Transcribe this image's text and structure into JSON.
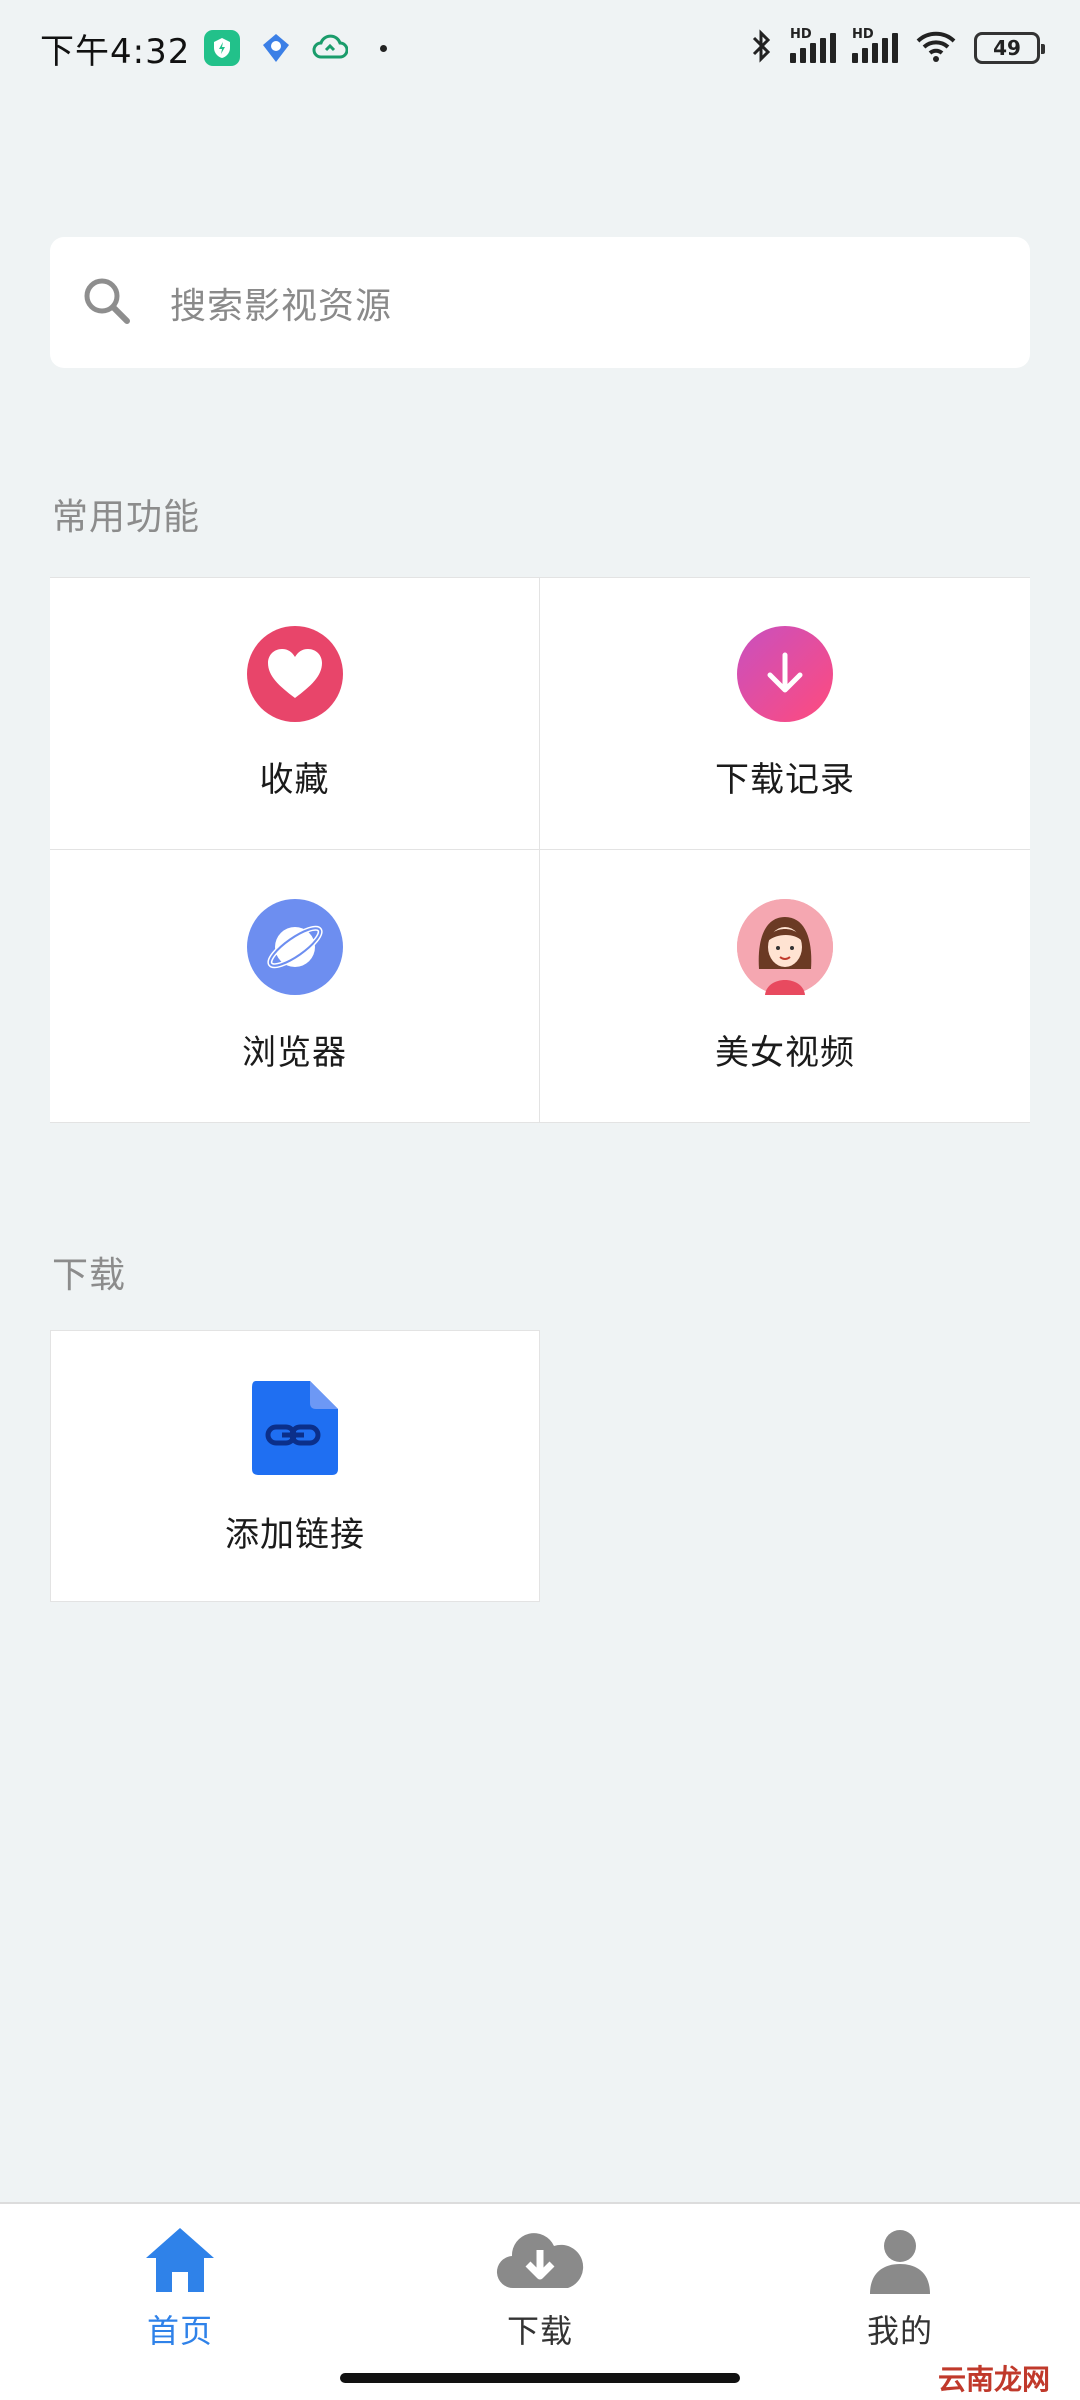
{
  "status_bar": {
    "time": "下午4:32",
    "battery": "49"
  },
  "search": {
    "placeholder": "搜索影视资源"
  },
  "section_common": {
    "title": "常用功能"
  },
  "features": [
    {
      "label": "收藏",
      "icon": "heart-icon",
      "color": "#e8456a"
    },
    {
      "label": "下载记录",
      "icon": "download-arrow-icon",
      "color": "#dd4fa0"
    },
    {
      "label": "浏览器",
      "icon": "planet-icon",
      "color": "#6d8ef0"
    },
    {
      "label": "美女视频",
      "icon": "girl-avatar-icon",
      "color": "#f29aa6"
    }
  ],
  "section_download": {
    "title": "下载",
    "add_link_label": "添加链接",
    "icon": "link-file-icon",
    "color": "#1f6ff2"
  },
  "bottom_nav": {
    "items": [
      {
        "label": "首页",
        "icon": "home-icon",
        "active": true
      },
      {
        "label": "下载",
        "icon": "cloud-download-icon",
        "active": false
      },
      {
        "label": "我的",
        "icon": "user-icon",
        "active": false
      }
    ],
    "active_color": "#2f82e9",
    "inactive_color": "#8a8a8a"
  },
  "watermark": "云南龙网"
}
